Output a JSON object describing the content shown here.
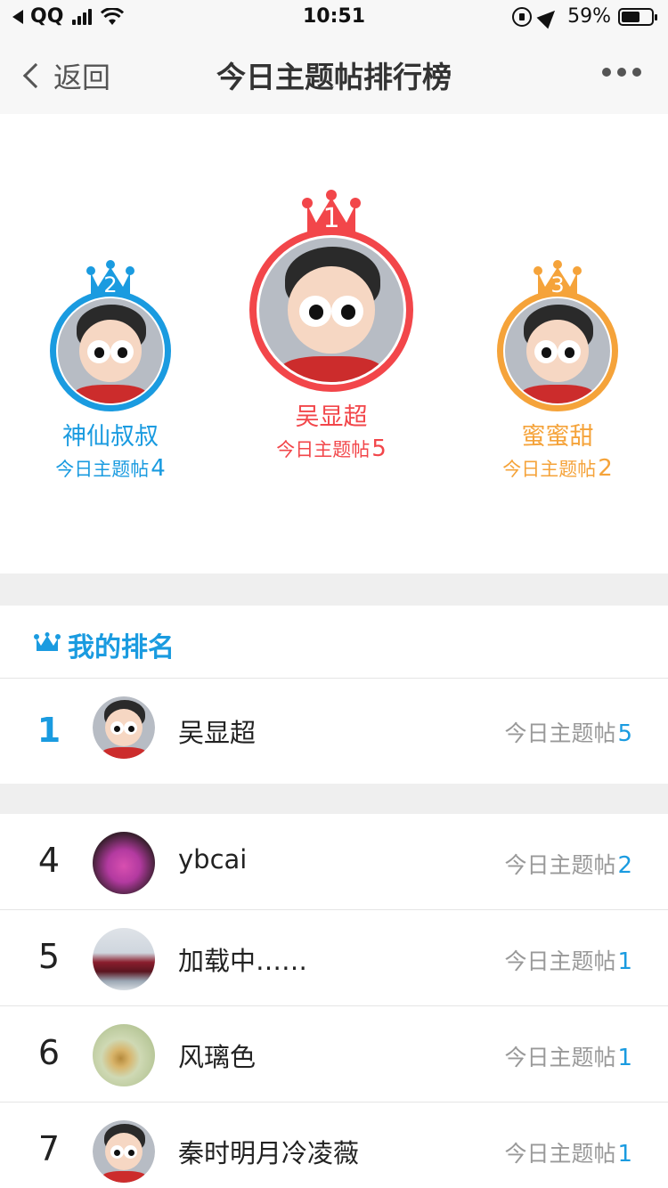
{
  "status_bar": {
    "carrier": "QQ",
    "time": "10:51",
    "battery": "59%",
    "battery_level": 0.59,
    "icons": [
      "back-arrow-icon",
      "signal-icon",
      "wifi-icon",
      "rotation-lock-icon",
      "location-icon",
      "battery-icon"
    ]
  },
  "nav": {
    "back_label": "返回",
    "title": "今日主题帖排行榜",
    "more_icon": "more-dots-icon"
  },
  "colors": {
    "blue": "#1a9be0",
    "red": "#f2464a",
    "orange": "#f5a33a",
    "text": "#222222",
    "subtext": "#999999",
    "divider": "#efefef"
  },
  "podium": {
    "first": {
      "rank": "1",
      "name": "吴显超",
      "label": "今日主题帖",
      "count": "5"
    },
    "second": {
      "rank": "2",
      "name": "神仙叔叔",
      "label": "今日主题帖",
      "count": "4"
    },
    "third": {
      "rank": "3",
      "name": "蜜蜜甜",
      "label": "今日主题帖",
      "count": "2"
    }
  },
  "my_rank": {
    "title": "我的排名",
    "rank": "1",
    "name": "吴显超",
    "label": "今日主题帖",
    "count": "5"
  },
  "list": [
    {
      "rank": "4",
      "name": "ybcai",
      "label": "今日主题帖",
      "count": "2"
    },
    {
      "rank": "5",
      "name": "加载中……",
      "label": "今日主题帖",
      "count": "1"
    },
    {
      "rank": "6",
      "name": "风璃色",
      "label": "今日主题帖",
      "count": "1"
    },
    {
      "rank": "7",
      "name": "秦时明月冷凌薇",
      "label": "今日主题帖",
      "count": "1"
    }
  ]
}
